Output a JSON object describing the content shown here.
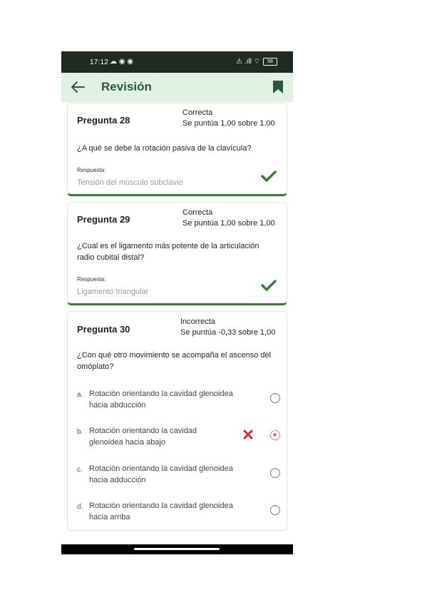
{
  "status_bar": {
    "time": "17:12",
    "left_icons": "☁ ◉ ◉",
    "right_icons": "⚠ .ıll ⌔",
    "battery": "58"
  },
  "app_bar": {
    "title": "Revisión",
    "back_icon": "arrow-left-icon",
    "bookmark_icon": "bookmark-icon",
    "bg_color": "#e1f1e3",
    "title_color": "#2a5a35"
  },
  "questions": [
    {
      "title": "Pregunta 28",
      "status": "Correcta",
      "score": "Se puntúa 1,00 sobre 1,00",
      "text": "¿A qué se debe la rotación pasiva de la clavícula?",
      "answer_label": "Respuesta:",
      "answer": "Tensión del músculo subclavio"
    },
    {
      "title": "Pregunta 29",
      "status": "Correcta",
      "score": "Se puntúa 1,00 sobre 1,00",
      "text": "¿Cual es el ligamento más potente de la articulación radio cubital distal?",
      "answer_label": "Respuesta:",
      "answer": "Ligamento triangular"
    },
    {
      "title": "Pregunta 30",
      "status": "Incorrecta",
      "score": "Se puntúa -0,33 sobre 1,00",
      "text": "¿Con qué otro movimiento se acompaña el ascenso del omóplato?",
      "options": [
        {
          "letter": "a.",
          "text": "Rotación orientando la cavidad glenoidea hacia abducción",
          "selected": false
        },
        {
          "letter": "b.",
          "text": "Rotación orientando la cavidad glenoidea hacia abajo",
          "selected": true,
          "wrong": true
        },
        {
          "letter": "c.",
          "text": "Rotación orientando la cavidad glenoidea hacia adducción",
          "selected": false
        },
        {
          "letter": "d.",
          "text": "Rotación orientando la cavidad glenoidea hacia arriba",
          "selected": false
        }
      ]
    }
  ],
  "colors": {
    "correct_green": "#3d7a3d",
    "wrong_red": "#d32f2f",
    "selected_radio": "#e07b7b"
  }
}
